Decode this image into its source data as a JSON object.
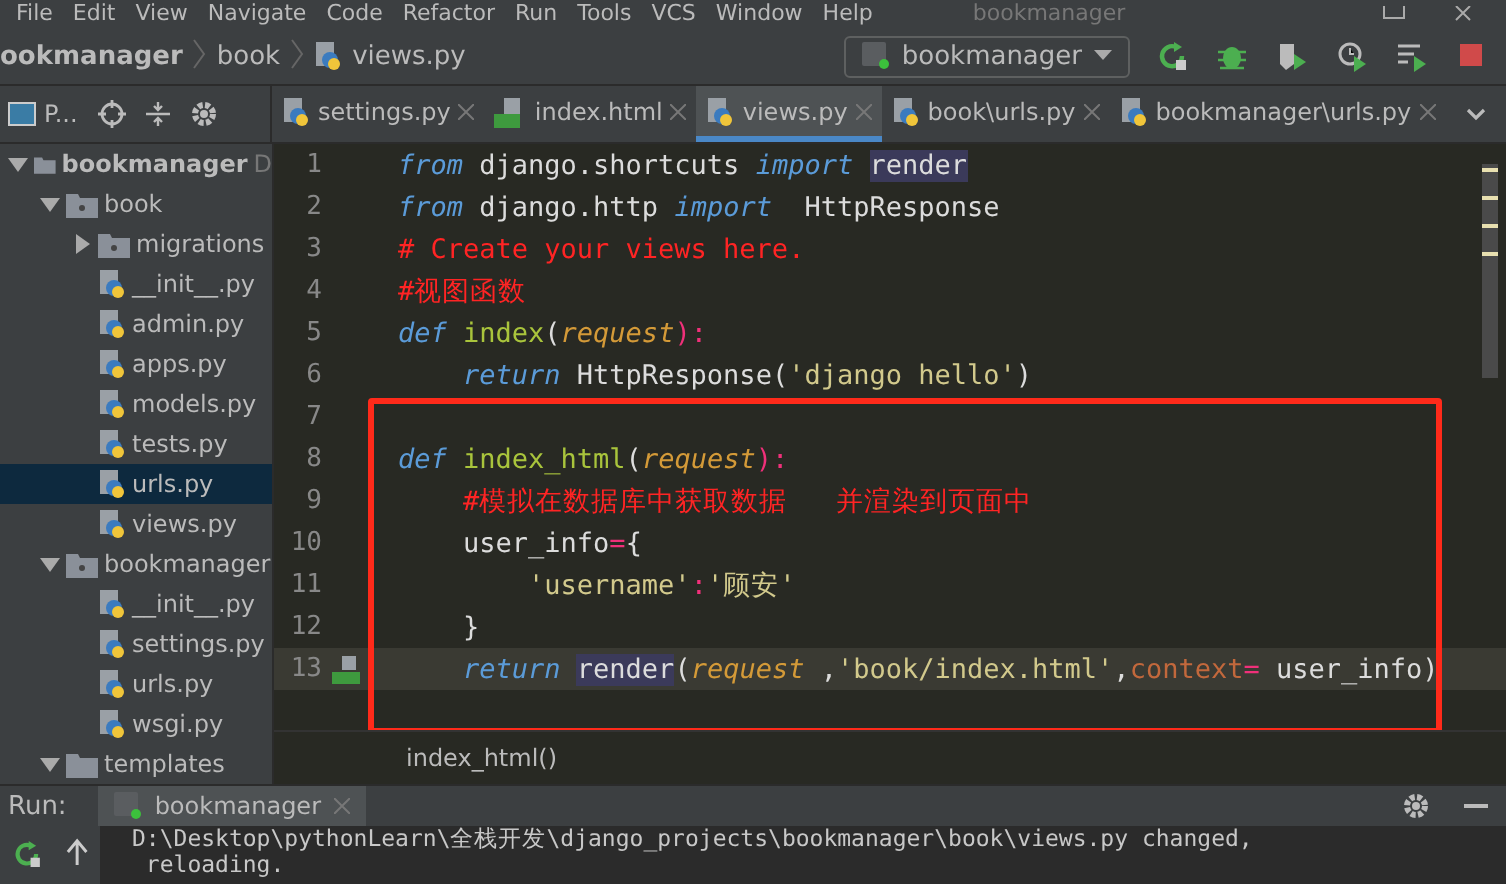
{
  "menu": [
    {
      "label": "File"
    },
    {
      "label": "Edit"
    },
    {
      "label": "View"
    },
    {
      "label": "Navigate"
    },
    {
      "label": "Code"
    },
    {
      "label": "Refactor"
    },
    {
      "label": "Run"
    },
    {
      "label": "Tools"
    },
    {
      "label": "VCS"
    },
    {
      "label": "Window"
    },
    {
      "label": "Help"
    }
  ],
  "window_title": "bookmanager",
  "breadcrumb": [
    {
      "label": "ookmanager",
      "kind": "project"
    },
    {
      "label": "book",
      "kind": "folder"
    },
    {
      "label": "views.py",
      "kind": "python"
    }
  ],
  "run_config": {
    "label": "bookmanager"
  },
  "project_toolbar": {
    "label": "P..."
  },
  "tabs": [
    {
      "label": "settings.py",
      "kind": "python",
      "selected": false
    },
    {
      "label": "index.html",
      "kind": "html",
      "selected": false
    },
    {
      "label": "views.py",
      "kind": "python",
      "selected": true
    },
    {
      "label": "book\\urls.py",
      "kind": "python",
      "selected": false
    },
    {
      "label": "bookmanager\\urls.py",
      "kind": "python",
      "selected": false
    }
  ],
  "tree": [
    {
      "label": "bookmanager",
      "kind": "project",
      "hint": "D",
      "expanded": true,
      "selected": false,
      "children": [
        {
          "label": "book",
          "kind": "package",
          "expanded": true,
          "selected": false,
          "children": [
            {
              "label": "migrations",
              "kind": "package",
              "expanded": false,
              "selected": false
            },
            {
              "label": "__init__.py",
              "kind": "python",
              "selected": false
            },
            {
              "label": "admin.py",
              "kind": "python",
              "selected": false
            },
            {
              "label": "apps.py",
              "kind": "python",
              "selected": false
            },
            {
              "label": "models.py",
              "kind": "python",
              "selected": false
            },
            {
              "label": "tests.py",
              "kind": "python",
              "selected": false
            },
            {
              "label": "urls.py",
              "kind": "python",
              "selected": true
            },
            {
              "label": "views.py",
              "kind": "python",
              "selected": false
            }
          ]
        },
        {
          "label": "bookmanager",
          "kind": "package",
          "expanded": true,
          "selected": false,
          "children": [
            {
              "label": "__init__.py",
              "kind": "python",
              "selected": false
            },
            {
              "label": "settings.py",
              "kind": "python",
              "selected": false
            },
            {
              "label": "urls.py",
              "kind": "python",
              "selected": false
            },
            {
              "label": "wsgi.py",
              "kind": "python",
              "selected": false
            }
          ]
        },
        {
          "label": "templates",
          "kind": "folder",
          "expanded": true,
          "selected": false
        }
      ]
    }
  ],
  "editor": {
    "lines": [
      {
        "number": "1",
        "current": false,
        "tokens": [
          {
            "text": "from",
            "kind": "kw"
          },
          {
            "text": " django.shortcuts ",
            "kind": "plain"
          },
          {
            "text": "import ",
            "kind": "kw"
          },
          {
            "text": "render",
            "kind": "plain",
            "marked": true
          }
        ]
      },
      {
        "number": "2",
        "current": false,
        "tokens": [
          {
            "text": "from",
            "kind": "kw"
          },
          {
            "text": " django.http ",
            "kind": "plain"
          },
          {
            "text": "import",
            "kind": "kw"
          },
          {
            "text": "  HttpResponse",
            "kind": "plain"
          }
        ]
      },
      {
        "number": "3",
        "current": false,
        "tokens": [
          {
            "text": "# Create your views here.",
            "kind": "comment"
          }
        ]
      },
      {
        "number": "4",
        "current": false,
        "tokens": [
          {
            "text": "#视图函数",
            "kind": "comment"
          }
        ]
      },
      {
        "number": "5",
        "current": false,
        "tokens": [
          {
            "text": "def ",
            "kind": "kw"
          },
          {
            "text": "index",
            "kind": "fn"
          },
          {
            "text": "(",
            "kind": "plain"
          },
          {
            "text": "request",
            "kind": "param"
          },
          {
            "text": "):",
            "kind": "op"
          }
        ]
      },
      {
        "number": "6",
        "current": false,
        "tokens": [
          {
            "text": "    return",
            "kind": "kw"
          },
          {
            "text": " HttpResponse(",
            "kind": "plain"
          },
          {
            "text": "'django hello'",
            "kind": "str"
          },
          {
            "text": ")",
            "kind": "plain"
          }
        ]
      },
      {
        "number": "7",
        "current": false
      },
      {
        "number": "8",
        "current": false,
        "tokens": [
          {
            "text": "def ",
            "kind": "kw"
          },
          {
            "text": "index_html",
            "kind": "fn"
          },
          {
            "text": "(",
            "kind": "plain"
          },
          {
            "text": "request",
            "kind": "param"
          },
          {
            "text": "):",
            "kind": "op"
          }
        ]
      },
      {
        "number": "9",
        "current": false,
        "tokens": [
          {
            "text": "    #模拟在数据库中获取数据   并渲染到页面中",
            "kind": "comment"
          }
        ]
      },
      {
        "number": "10",
        "current": false,
        "tokens": [
          {
            "text": "    user_info",
            "kind": "plain"
          },
          {
            "text": "=",
            "kind": "op"
          },
          {
            "text": "{",
            "kind": "plain"
          }
        ]
      },
      {
        "number": "11",
        "current": false,
        "tokens": [
          {
            "text": "        'username'",
            "kind": "str"
          },
          {
            "text": ":",
            "kind": "op"
          },
          {
            "text": "'顾安'",
            "kind": "str"
          }
        ]
      },
      {
        "number": "12",
        "current": false,
        "tokens": [
          {
            "text": "    }",
            "kind": "plain"
          }
        ]
      },
      {
        "number": "13",
        "current": true,
        "gutter_marker": true,
        "tokens": [
          {
            "text": "    return ",
            "kind": "kw"
          },
          {
            "text": "render",
            "kind": "plain",
            "marked": true
          },
          {
            "text": "(",
            "kind": "plain"
          },
          {
            "text": "request",
            "kind": "param"
          },
          {
            "text": " ,",
            "kind": "plain"
          },
          {
            "text": "'book/index.html'",
            "kind": "str"
          },
          {
            "text": ",",
            "kind": "plain"
          },
          {
            "text": "context",
            "kind": "kwarg"
          },
          {
            "text": "=",
            "kind": "op"
          },
          {
            "text": " user_info)",
            "kind": "plain"
          }
        ]
      }
    ],
    "breadcrumb": "index_html()"
  },
  "run_panel": {
    "label": "Run:",
    "tab": "bookmanager",
    "console": [
      "D:\\Desktop\\pythonLearn\\全栈开发\\django_projects\\bookmanager\\book\\views.py changed,",
      " reloading."
    ]
  }
}
